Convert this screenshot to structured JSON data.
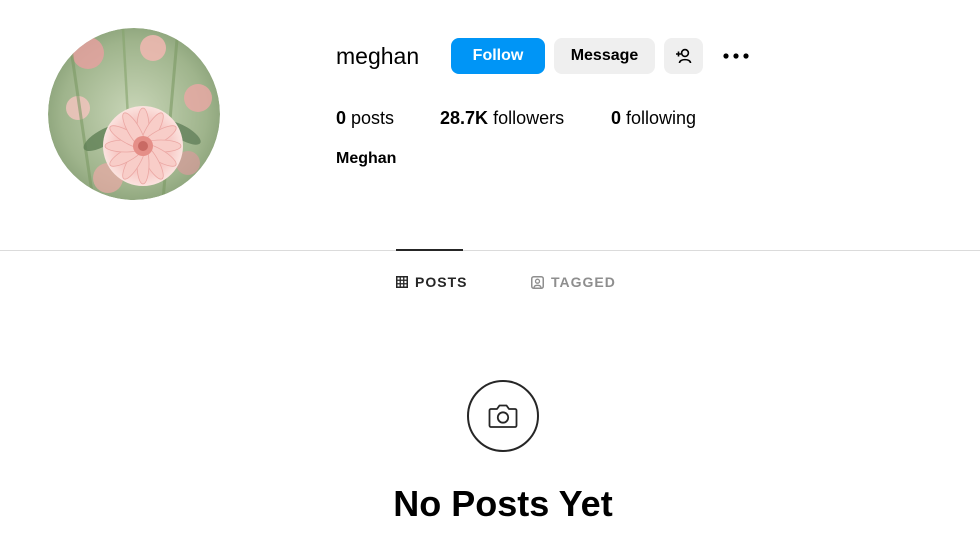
{
  "profile": {
    "username": "meghan",
    "display_name": "Meghan",
    "avatar_icon": "flower-photo"
  },
  "actions": {
    "follow_label": "Follow",
    "message_label": "Message",
    "add_user_icon": "add-user-icon",
    "more_icon": "more-options-icon"
  },
  "stats": {
    "posts_count": "0",
    "posts_label": "posts",
    "followers_count": "28.7K",
    "followers_label": "followers",
    "following_count": "0",
    "following_label": "following"
  },
  "tabs": [
    {
      "label": "POSTS",
      "icon": "grid-icon",
      "active": true
    },
    {
      "label": "TAGGED",
      "icon": "tagged-icon",
      "active": false
    }
  ],
  "empty_state": {
    "icon": "camera-icon",
    "title": "No Posts Yet"
  },
  "colors": {
    "accent": "#0095f6",
    "secondary_button": "#efefef",
    "divider": "#dbdbdb",
    "inactive_tab": "#8e8e8e"
  }
}
